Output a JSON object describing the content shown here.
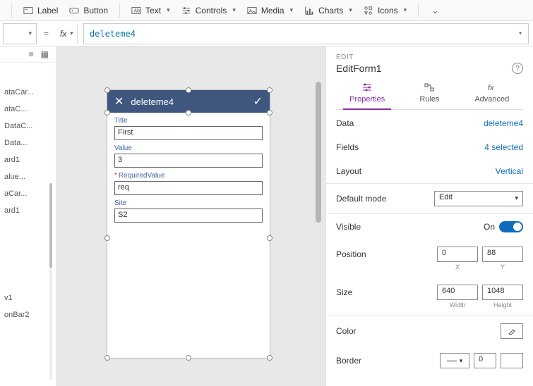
{
  "ribbon": {
    "label": "Label",
    "button": "Button",
    "text": "Text",
    "controls": "Controls",
    "media": "Media",
    "charts": "Charts",
    "icons": "Icons"
  },
  "formula": {
    "fx": "fx",
    "value": "deleteme4"
  },
  "tree": {
    "items": [
      "ataCar...",
      "ataC...",
      "DataC...",
      "Data...",
      "ard1",
      "alue...",
      "aCar...",
      "ard1"
    ],
    "lower": [
      "v1",
      "onBar2"
    ]
  },
  "form": {
    "title": "deleteme4",
    "fields": [
      {
        "label": "Title",
        "value": "First",
        "required": false
      },
      {
        "label": "Value",
        "value": "3",
        "required": false
      },
      {
        "label": "RequiredValue",
        "value": "req",
        "required": true
      },
      {
        "label": "Site",
        "value": "S2",
        "required": false
      }
    ]
  },
  "panel": {
    "type": "EDIT",
    "name": "EditForm1",
    "tabs": {
      "properties": "Properties",
      "rules": "Rules",
      "advanced": "Advanced"
    },
    "data": {
      "label": "Data",
      "value": "deleteme4"
    },
    "fields": {
      "label": "Fields",
      "value": "4 selected"
    },
    "layout": {
      "label": "Layout",
      "value": "Vertical"
    },
    "defaultmode": {
      "label": "Default mode",
      "value": "Edit"
    },
    "visible": {
      "label": "Visible",
      "value": "On"
    },
    "position": {
      "label": "Position",
      "x": "0",
      "y": "88",
      "xl": "X",
      "yl": "Y"
    },
    "size": {
      "label": "Size",
      "w": "640",
      "h": "1048",
      "wl": "Width",
      "hl": "Height"
    },
    "color": {
      "label": "Color"
    },
    "border": {
      "label": "Border",
      "width": "0"
    }
  }
}
